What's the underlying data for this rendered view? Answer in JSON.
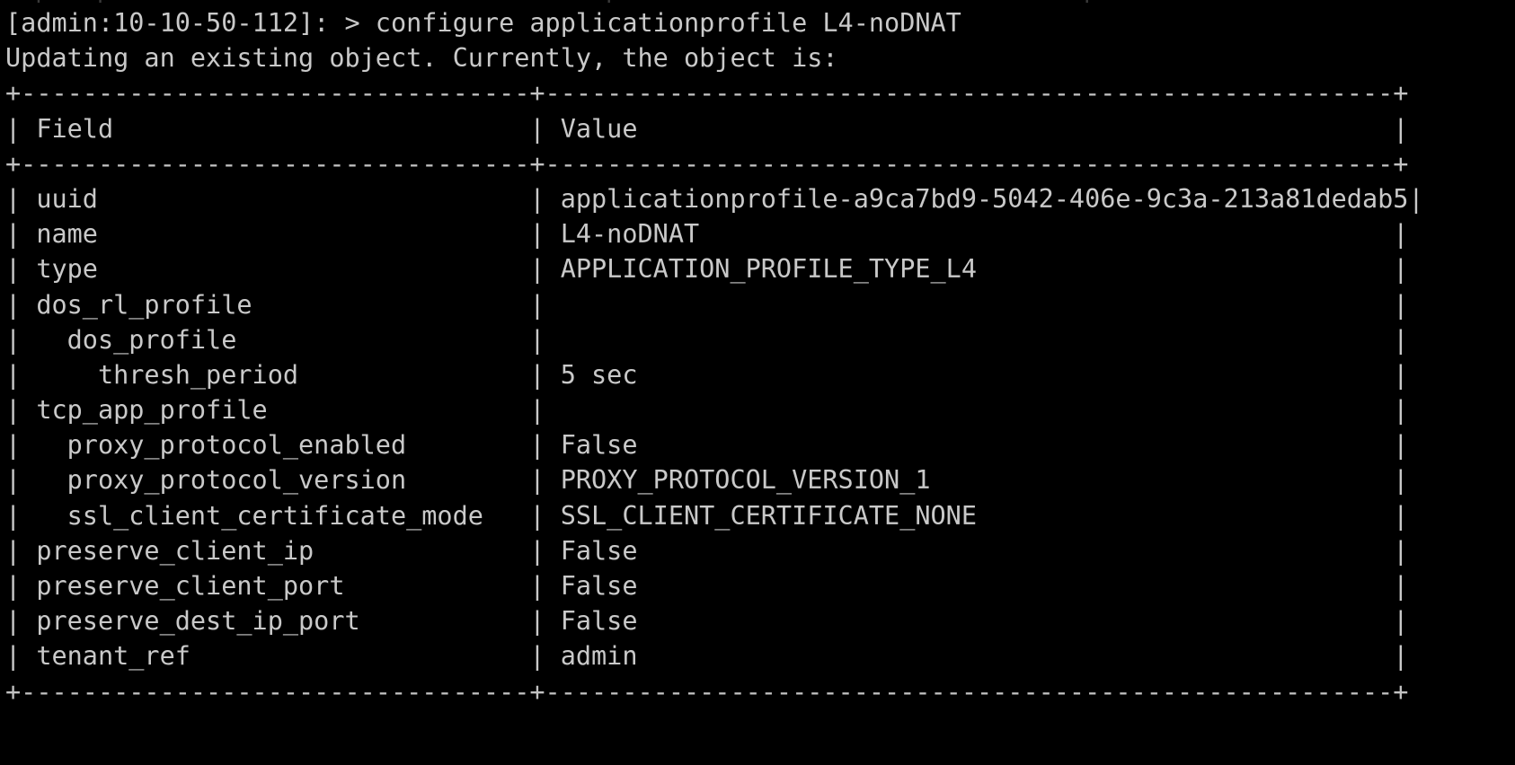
{
  "terminal": {
    "background_color": "#000000",
    "foreground_color": "#c9c9c9",
    "prompt": "[admin:10-10-50-112]: > ",
    "command": "configure applicationprofile L4-noDNAT",
    "prompt_line": "[admin:10-10-50-112]: > configure applicationprofile L4-noDNAT",
    "status_line": "Updating an existing object. Currently, the object is:",
    "scrollback_partial": "  |   |                                |                              |"
  },
  "table": {
    "border_top": "+---------------------------------+-------------------------------------------------------+",
    "border_header": "+---------------------------------+-------------------------------------------------------+",
    "border_bottom": "+---------------------------------+-------------------------------------------------------+",
    "headers": [
      "Field",
      "Value"
    ],
    "header_row": "| Field                           | Value                                                 |",
    "field_col_width": 33,
    "value_col_width": 55,
    "rows": [
      {
        "indent": 0,
        "field": "uuid",
        "value": "applicationprofile-a9ca7bd9-5042-406e-9c3a-213a81dedab5"
      },
      {
        "indent": 0,
        "field": "name",
        "value": "L4-noDNAT"
      },
      {
        "indent": 0,
        "field": "type",
        "value": "APPLICATION_PROFILE_TYPE_L4"
      },
      {
        "indent": 0,
        "field": "dos_rl_profile",
        "value": ""
      },
      {
        "indent": 1,
        "field": "dos_profile",
        "value": ""
      },
      {
        "indent": 2,
        "field": "thresh_period",
        "value": "5 sec"
      },
      {
        "indent": 0,
        "field": "tcp_app_profile",
        "value": ""
      },
      {
        "indent": 1,
        "field": "proxy_protocol_enabled",
        "value": "False"
      },
      {
        "indent": 1,
        "field": "proxy_protocol_version",
        "value": "PROXY_PROTOCOL_VERSION_1"
      },
      {
        "indent": 1,
        "field": "ssl_client_certificate_mode",
        "value": "SSL_CLIENT_CERTIFICATE_NONE"
      },
      {
        "indent": 0,
        "field": "preserve_client_ip",
        "value": "False"
      },
      {
        "indent": 0,
        "field": "preserve_client_port",
        "value": "False"
      },
      {
        "indent": 0,
        "field": "preserve_dest_ip_port",
        "value": "False"
      },
      {
        "indent": 0,
        "field": "tenant_ref",
        "value": "admin"
      }
    ]
  }
}
